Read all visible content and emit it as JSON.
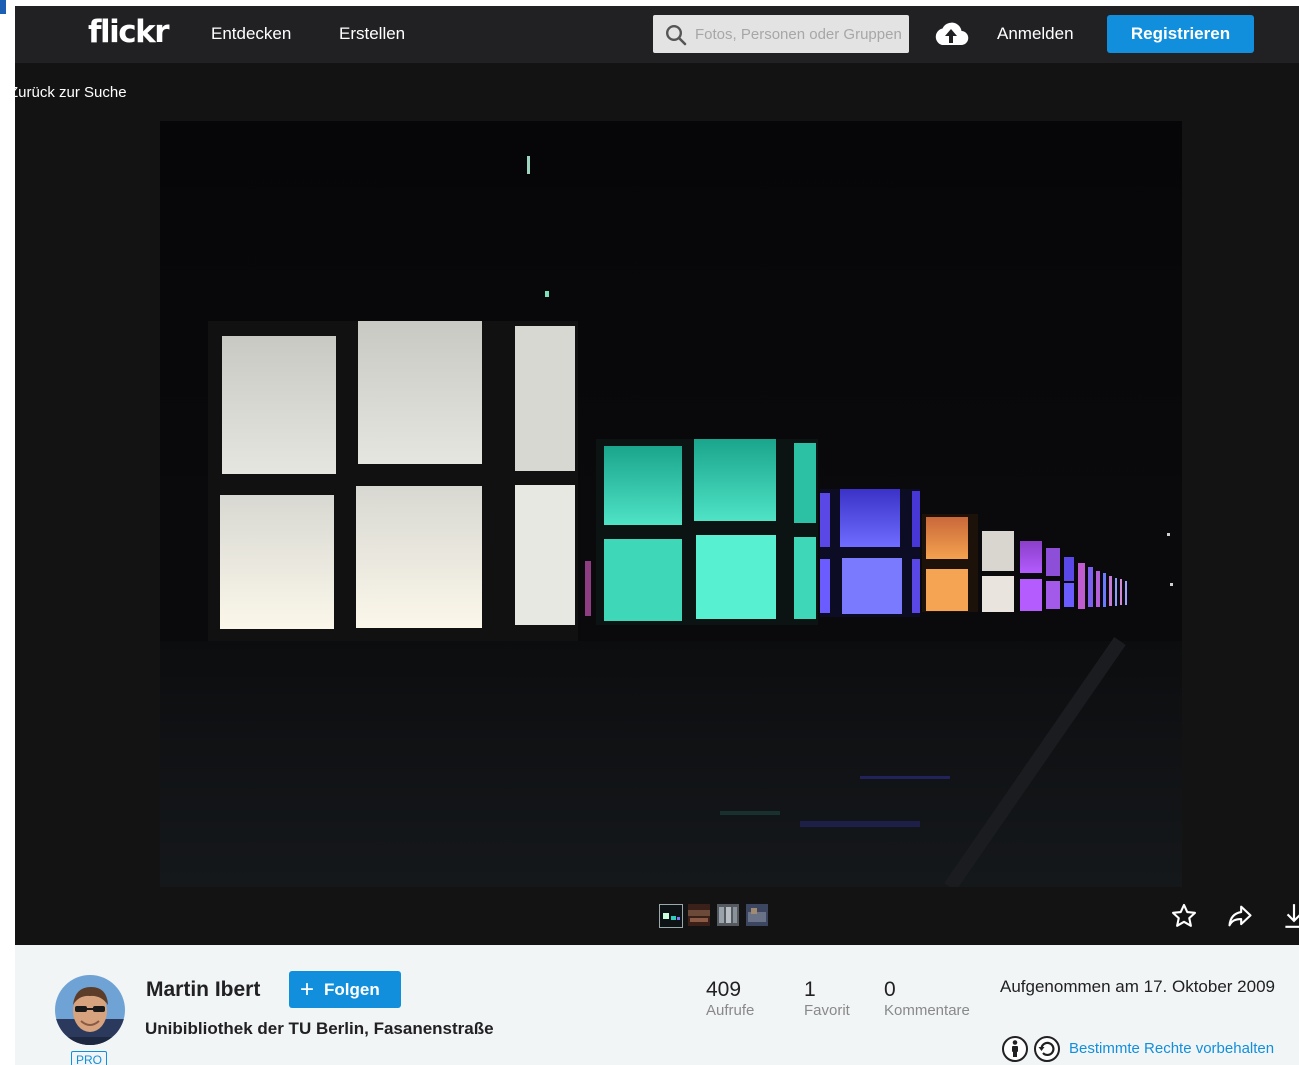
{
  "header": {
    "logo": "flickr",
    "nav": [
      "Entdecken",
      "Erstellen"
    ],
    "search_placeholder": "Fotos, Personen oder Gruppen",
    "login_label": "Anmelden",
    "register_label": "Registrieren"
  },
  "back_link": "Zurück zur Suche",
  "photo": {
    "thumbnails": [
      "thumb-1",
      "thumb-2",
      "thumb-3",
      "thumb-4"
    ],
    "actions": [
      "star-icon",
      "share-icon",
      "download-icon"
    ]
  },
  "owner": {
    "name": "Martin Ibert",
    "badge": "PRO",
    "follow_label": "Folgen"
  },
  "title": "Unibibliothek der TU Berlin, Fasanenstraße",
  "stats": [
    {
      "value": "409",
      "label": "Aufrufe"
    },
    {
      "value": "1",
      "label": "Favorit"
    },
    {
      "value": "0",
      "label": "Kommentare"
    }
  ],
  "taken": "Aufgenommen am 17. Oktober 2009",
  "license": "Bestimmte Rechte vorbehalten",
  "colors": {
    "brand_blue": "#128fdc",
    "header_bg": "#212124",
    "page_bg": "#131313",
    "info_bg": "#f2f5f6"
  }
}
